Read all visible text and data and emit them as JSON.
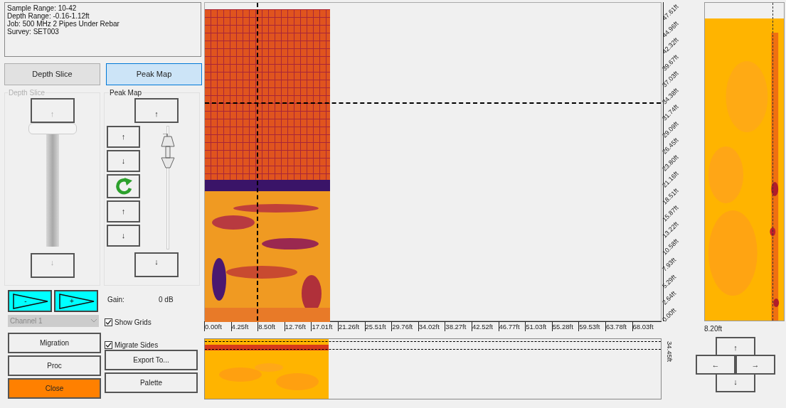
{
  "info": [
    "Sample Range: 10-42",
    "Depth Range: -0.16-1.12ft",
    "Job: 500 MHz 2 Pipes Under Rebar",
    "Survey: SET003"
  ],
  "tabs": [
    {
      "label": "Depth Slice",
      "selected": false
    },
    {
      "label": "Peak Map",
      "selected": true
    }
  ],
  "depth_slice": {
    "title": "Depth Slice",
    "disabled": true,
    "up": "↑",
    "down": "↓",
    "level": 1
  },
  "peak_map": {
    "title": "Peak Map",
    "up": "↑",
    "down": "↓",
    "level": 0.93,
    "small_buttons": [
      {
        "kind": "arrow",
        "label": "↑"
      },
      {
        "kind": "arrow",
        "label": "↓"
      },
      {
        "kind": "refresh"
      },
      {
        "kind": "arrow",
        "label": "↑"
      },
      {
        "kind": "arrow",
        "label": "↓"
      }
    ]
  },
  "amp_buttons": [
    {
      "sign": "-"
    },
    {
      "sign": "+"
    }
  ],
  "gain": {
    "label": "Gain:",
    "value": "0 dB"
  },
  "channel": {
    "value": "Channel 1",
    "disabled": true
  },
  "checkboxes": [
    {
      "label": "Show Grids",
      "checked": true
    },
    {
      "label": "Migrate Sides",
      "checked": true
    }
  ],
  "buttons_left": [
    {
      "label": "Migration",
      "kind": "plain"
    },
    {
      "label": "Proc",
      "kind": "plain"
    },
    {
      "label": "Close",
      "kind": "accent"
    }
  ],
  "buttons_right": [
    {
      "label": "Export To..."
    },
    {
      "label": "Palette"
    }
  ],
  "plot": {
    "yticks": [
      "47.61ft",
      "44.96ft",
      "42.32ft",
      "39.67ft",
      "37.03ft",
      "34.38ft",
      "31.74ft",
      "29.09ft",
      "26.45ft",
      "23.80ft",
      "21.16ft",
      "18.51ft",
      "15.87ft",
      "13.22ft",
      "10.58ft",
      "7.93ft",
      "5.29ft",
      "2.64ft",
      "0.00ft"
    ],
    "xticks": [
      "0.00ft",
      "4.25ft",
      "8.50ft",
      "12.76ft",
      "17.01ft",
      "21.26ft",
      "25.51ft",
      "29.76ft",
      "34.02ft",
      "38.27ft",
      "42.52ft",
      "46.77ft",
      "51.03ft",
      "55.28ft",
      "59.53ft",
      "63.78ft",
      "68.03ft"
    ]
  },
  "strip": {
    "label": "34.45ft"
  },
  "side": {
    "label": "8.20ft"
  },
  "nav": {
    "up": "↑",
    "left": "←",
    "right": "→",
    "down": "↓"
  }
}
